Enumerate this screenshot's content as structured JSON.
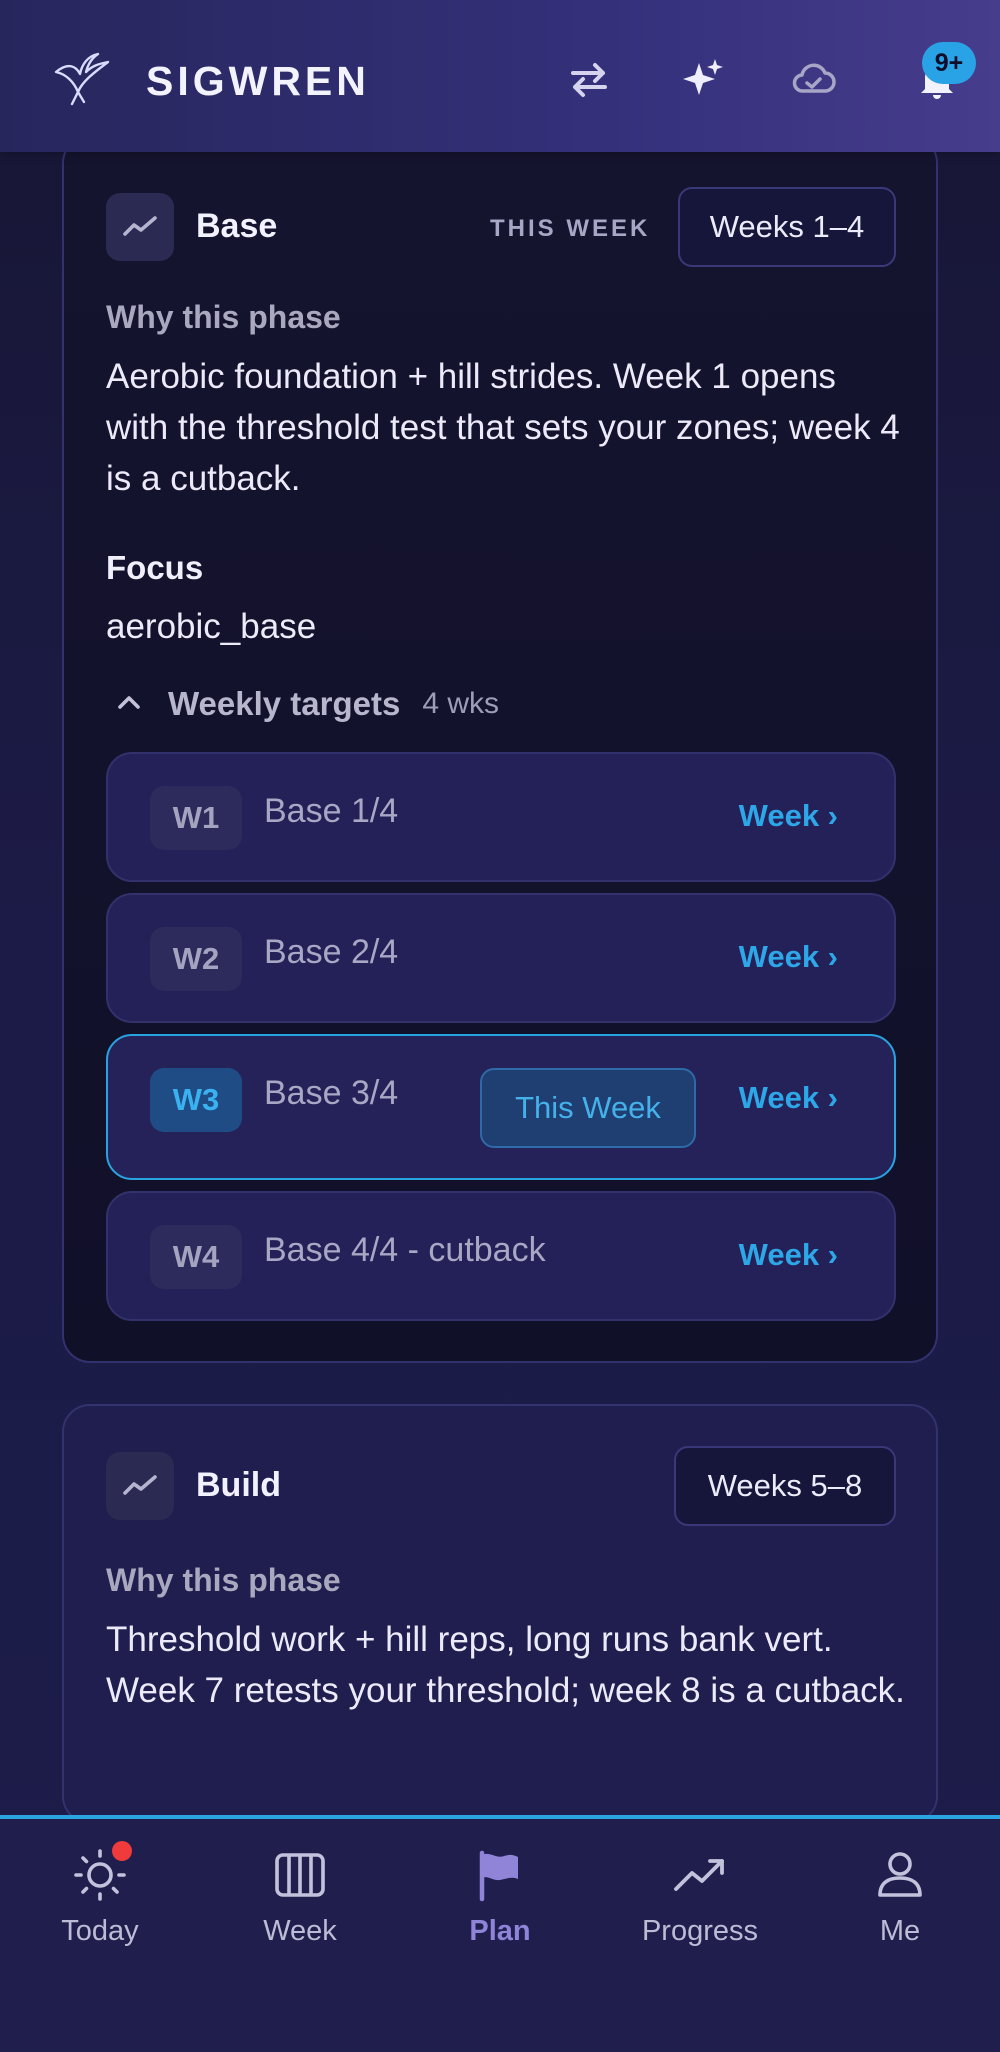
{
  "header": {
    "brand": "SIGWREN",
    "icons": [
      "swap-icon",
      "sparkles-icon",
      "cloud-check-icon",
      "bell-icon"
    ],
    "notification_badge": "9+"
  },
  "base_phase": {
    "title": "Base",
    "this_week_label": "THIS WEEK",
    "weeks_range": "Weeks 1–4",
    "why_label": "Why this phase",
    "why_text": "Aerobic foundation + hill strides. Week 1 opens with the threshold test that sets your zones; week 4 is a cutback.",
    "focus_label": "Focus",
    "focus_value": "aerobic_base",
    "targets_title": "Weekly targets",
    "targets_count": "4 wks",
    "weeks": [
      {
        "badge": "W1",
        "label": "Base 1/4",
        "link": "Week ›"
      },
      {
        "badge": "W2",
        "label": "Base 2/4",
        "link": "Week ›"
      },
      {
        "badge": "W3",
        "label": "Base 3/4",
        "link": "Week ›",
        "chip": "This Week"
      },
      {
        "badge": "W4",
        "label": "Base 4/4 - cutback",
        "link": "Week ›"
      }
    ]
  },
  "build_phase": {
    "title": "Build",
    "weeks_range": "Weeks 5–8",
    "why_label": "Why this phase",
    "why_text": "Threshold work + hill reps, long runs bank vert. Week 7 retests your threshold; week 8 is a cutback."
  },
  "nav": {
    "items": [
      {
        "label": "Today",
        "icon": "sun-icon"
      },
      {
        "label": "Week",
        "icon": "calendar-columns-icon"
      },
      {
        "label": "Plan",
        "icon": "flag-icon"
      },
      {
        "label": "Progress",
        "icon": "trending-up-icon"
      },
      {
        "label": "Me",
        "icon": "user-icon"
      }
    ],
    "active": "Plan"
  },
  "colors": {
    "accent": "#2aa3e6",
    "active_nav": "#8f84d8",
    "notification": "#ef3b3b"
  }
}
